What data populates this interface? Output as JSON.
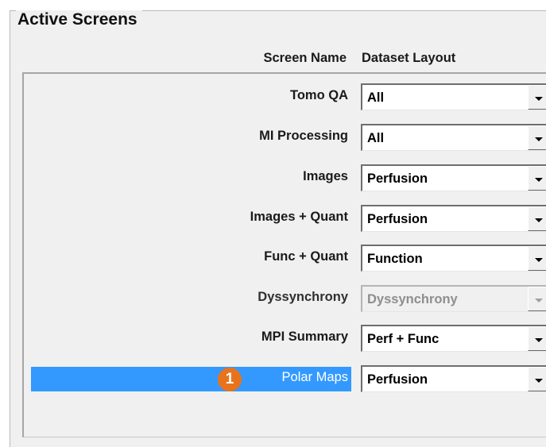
{
  "group_title": "Active Screens",
  "columns": {
    "screen_name": "Screen Name",
    "dataset_layout": "Dataset Layout"
  },
  "rows": [
    {
      "name": "Tomo QA",
      "layout": "All",
      "enabled": true,
      "selected": false
    },
    {
      "name": "MI Processing",
      "layout": "All",
      "enabled": true,
      "selected": false
    },
    {
      "name": "Images",
      "layout": "Perfusion",
      "enabled": true,
      "selected": false
    },
    {
      "name": "Images + Quant",
      "layout": "Perfusion",
      "enabled": true,
      "selected": false
    },
    {
      "name": "Func + Quant",
      "layout": "Function",
      "enabled": true,
      "selected": false
    },
    {
      "name": "Dyssynchrony",
      "layout": "Dyssynchrony",
      "enabled": false,
      "selected": false
    },
    {
      "name": "MPI Summary",
      "layout": "Perf + Func",
      "enabled": true,
      "selected": false
    },
    {
      "name": "Polar Maps",
      "layout": "Perfusion",
      "enabled": true,
      "selected": true
    }
  ],
  "callout_badge": "1",
  "colors": {
    "selection": "#3399ff",
    "badge": "#e8731c",
    "background": "#f0f0f0"
  },
  "icons": {
    "dropdown": "chevron-down-icon"
  }
}
